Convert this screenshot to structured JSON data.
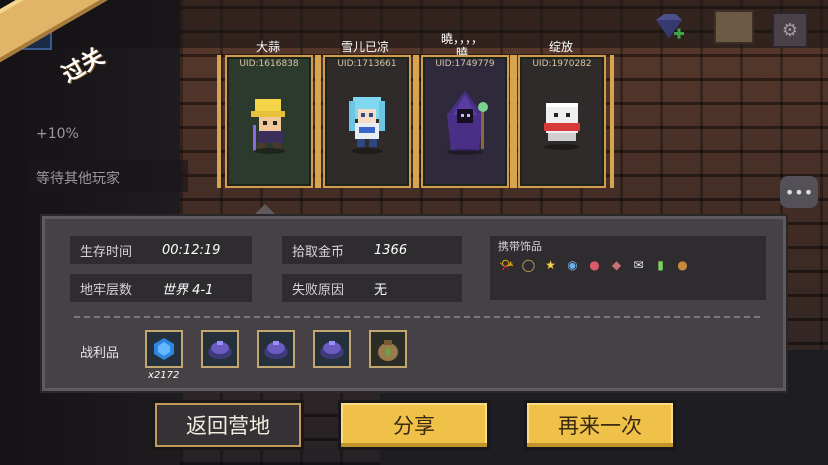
{
  "banner": {
    "label": "过关"
  },
  "sidebar": {
    "multiplier": "+10%",
    "waiting": "等待其他玩家"
  },
  "players": [
    {
      "name": "大蒜",
      "uid": "UID:1616838",
      "sprite": "knight-yellow-hat"
    },
    {
      "name": "雪儿已凉",
      "uid": "UID:1713661",
      "sprite": "girl-blue-hair"
    },
    {
      "name": "曉，，，，\n曉",
      "name_line1": "曉，，，，",
      "name_line2": "曉",
      "uid": "UID:1749779",
      "sprite": "purple-hooded-wizard"
    },
    {
      "name": "绽放",
      "uid": "UID:1970282",
      "sprite": "white-box-creature"
    }
  ],
  "stats": {
    "survival_label": "生存时间",
    "survival_value": "00:12:19",
    "gold_label": "拾取金币",
    "gold_value": "1366",
    "floor_label": "地牢层数",
    "floor_value": "世界 4-1",
    "fail_label": "失败原因",
    "fail_value": "无"
  },
  "accessories": {
    "title": "携带饰品",
    "items": [
      "horn-icon",
      "ring-icon",
      "star-icon",
      "orb-icon",
      "steak-icon",
      "meat-icon",
      "letter-icon",
      "potion-icon",
      "pouch-icon"
    ]
  },
  "loot": {
    "label": "战利品",
    "items": [
      {
        "icon": "blue-gem-icon",
        "count": "x2172"
      },
      {
        "icon": "purple-material-icon"
      },
      {
        "icon": "purple-material-icon"
      },
      {
        "icon": "purple-material-icon"
      },
      {
        "icon": "seed-bag-icon"
      }
    ]
  },
  "buttons": {
    "back": "返回营地",
    "share": "分享",
    "again": "再来一次"
  },
  "colors": {
    "gold": "#efc149",
    "frame": "#d39b4c",
    "panel": "#454145"
  }
}
